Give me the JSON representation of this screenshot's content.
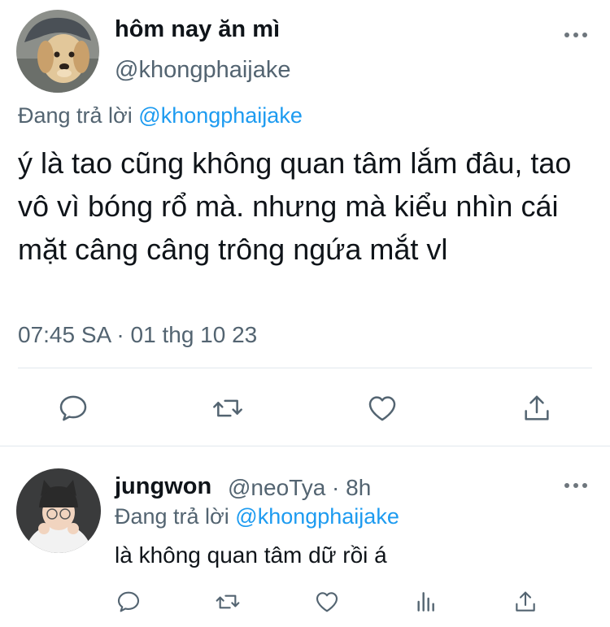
{
  "main_tweet": {
    "author_name": "hôm nay ăn mì",
    "author_handle": "@khongphaijake",
    "reply_prefix": "Đang trả lời",
    "reply_mention": "@khongphaijake",
    "text": "ý là tao cũng không quan tâm lắm đâu, tao vô vì bóng rổ mà. nhưng mà kiểu nhìn cái mặt câng câng trông ngứa mắt vl",
    "timestamp": "07:45 SA · 01 thg 10 23",
    "actions": [
      "reply-icon",
      "retweet-icon",
      "like-icon",
      "share-icon"
    ]
  },
  "reply_tweet": {
    "author_name": "jungwon",
    "author_meta": "@neoTya · 8h",
    "reply_prefix": "Đang trả lời",
    "reply_mention": "@khongphaijake",
    "text": "là không quan tâm dữ rồi á",
    "actions": [
      "reply-icon",
      "retweet-icon",
      "like-icon",
      "analytics-icon",
      "share-icon"
    ]
  },
  "colors": {
    "text": "#0f1419",
    "secondary": "#536471",
    "link": "#1d9bf0",
    "icon": "#536471",
    "divider": "#e1e8ed"
  }
}
